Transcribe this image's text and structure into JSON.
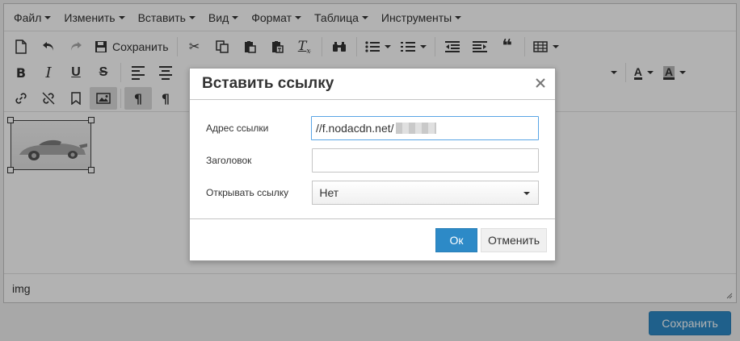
{
  "menubar": {
    "items": [
      "Файл",
      "Изменить",
      "Вставить",
      "Вид",
      "Формат",
      "Таблица",
      "Инструменты"
    ]
  },
  "toolbar": {
    "save_label": "Сохранить"
  },
  "editor": {
    "status_path": "img"
  },
  "page": {
    "save_label": "Сохранить"
  },
  "dialog": {
    "title": "Вставить ссылку",
    "fields": {
      "url_label": "Адрес ссылки",
      "url_value": "//f.nodacdn.net/",
      "title_label": "Заголовок",
      "title_value": "",
      "open_label": "Открывать ссылку",
      "open_value": "Нет"
    },
    "ok_label": "Ок",
    "cancel_label": "Отменить"
  },
  "colors": {
    "primary": "#2d8ac7",
    "overlay": "rgba(0,0,0,0.30)"
  }
}
